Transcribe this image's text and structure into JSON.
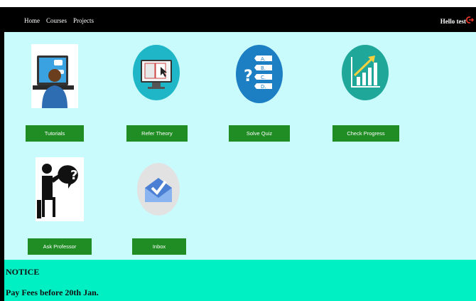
{
  "nav": {
    "home": "Home",
    "courses": "Courses",
    "projects": "Projects",
    "greeting": "Hello test"
  },
  "tiles": [
    {
      "label": "Tutorials",
      "icon": "online-learning-icon"
    },
    {
      "label": "Refer Theory",
      "icon": "monitor-book-icon"
    },
    {
      "label": "Solve Quiz",
      "icon": "quiz-options-icon"
    },
    {
      "label": "Check Progress",
      "icon": "progress-chart-icon"
    },
    {
      "label": "Ask Professor",
      "icon": "ask-question-icon"
    },
    {
      "label": "Inbox",
      "icon": "inbox-icon"
    }
  ],
  "notice": {
    "title": "NOTICE",
    "text": "Pay Fees before 20th Jan."
  },
  "colors": {
    "navbar": "#000000",
    "content_bg": "#c9fbfd",
    "button": "#1f8c24",
    "notice_bg": "#00f0c4",
    "logout": "#e0342b"
  }
}
